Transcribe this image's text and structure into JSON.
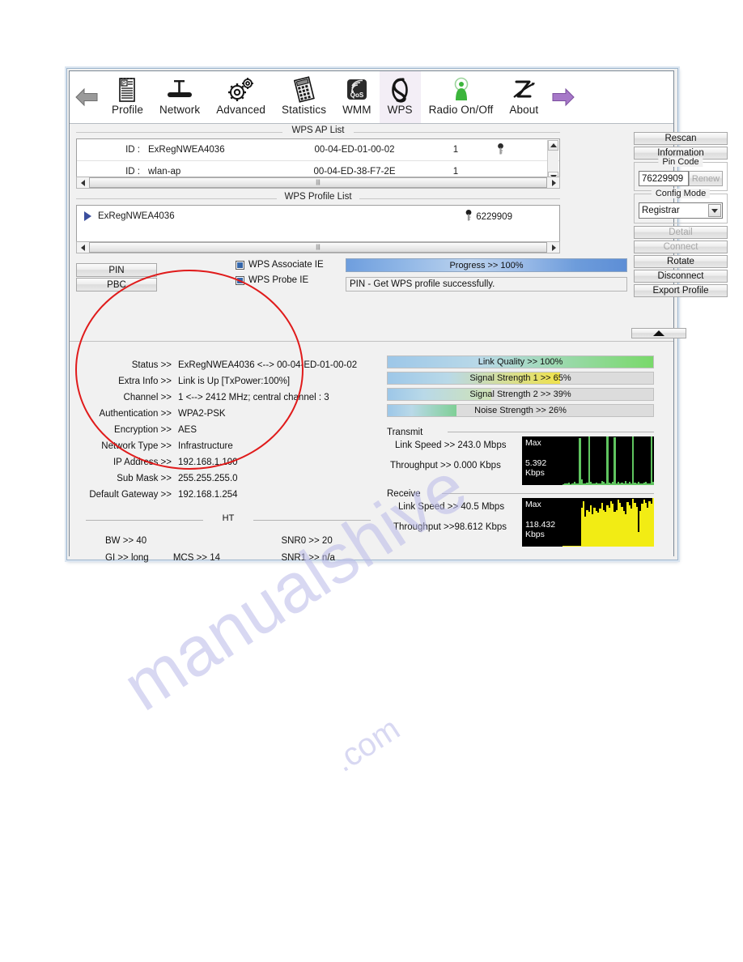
{
  "watermark": {
    "line1": "manualshive",
    "line2": ".com"
  },
  "toolbar": {
    "prev_label": "",
    "next_label": "",
    "items": [
      {
        "label": "Profile",
        "icon": "profile-icon",
        "active": false
      },
      {
        "label": "Network",
        "icon": "network-icon",
        "active": false
      },
      {
        "label": "Advanced",
        "icon": "advanced-icon",
        "active": false
      },
      {
        "label": "Statistics",
        "icon": "statistics-icon",
        "active": false
      },
      {
        "label": "WMM",
        "icon": "wmm-qos-icon",
        "active": false
      },
      {
        "label": "WPS",
        "icon": "wps-icon",
        "active": true
      },
      {
        "label": "Radio On/Off",
        "icon": "radio-icon",
        "active": false
      },
      {
        "label": "About",
        "icon": "about-icon",
        "active": false
      }
    ]
  },
  "ap_list": {
    "title": "WPS AP List",
    "rows": [
      {
        "id_label": "ID :",
        "ssid": "ExRegNWEA4036",
        "mac": "00-04-ED-01-00-02",
        "channel": "1"
      },
      {
        "id_label": "ID :",
        "ssid": "wlan-ap",
        "mac": "00-04-ED-38-F7-2E",
        "channel": "1"
      }
    ]
  },
  "profile_list": {
    "title": "WPS Profile List",
    "rows": [
      {
        "name": "ExRegNWEA4036",
        "pin": "6229909"
      }
    ]
  },
  "actions": {
    "pin_label": "PIN",
    "pbc_label": "PBC",
    "associate_ie_label": "WPS Associate IE",
    "probe_ie_label": "WPS Probe IE"
  },
  "progress": {
    "text": "Progress >> 100%",
    "percent": 100,
    "message": "PIN - Get WPS profile successfully."
  },
  "right_panel": {
    "rescan_label": "Rescan",
    "information_label": "Information",
    "pin_code_legend": "Pin Code",
    "pin_code_value": "76229909",
    "renew_label": "Renew",
    "config_mode_legend": "Config Mode",
    "config_mode_value": "Registrar",
    "detail_label": "Detail",
    "connect_label": "Connect",
    "rotate_label": "Rotate",
    "disconnect_label": "Disconnect",
    "export_profile_label": "Export Profile"
  },
  "status": {
    "rows": [
      {
        "label": "Status >>",
        "value": "ExRegNWEA4036 <-->  00-04-ED-01-00-02"
      },
      {
        "label": "Extra Info >>",
        "value": "Link is Up [TxPower:100%]"
      },
      {
        "label": "Channel >>",
        "value": "1 <--> 2412 MHz; central channel : 3"
      },
      {
        "label": "Authentication >>",
        "value": "WPA2-PSK"
      },
      {
        "label": "Encryption >>",
        "value": "AES"
      },
      {
        "label": "Network Type >>",
        "value": "Infrastructure"
      },
      {
        "label": "IP Address >>",
        "value": "192.168.1.100"
      },
      {
        "label": "Sub Mask >>",
        "value": "255.255.255.0"
      },
      {
        "label": "Default Gateway >>",
        "value": "192.168.1.254"
      }
    ]
  },
  "ht": {
    "title": "HT",
    "bw": "BW >> 40",
    "snr0": "SNR0 >>   20",
    "gi": "GI >> long",
    "mcs": "MCS >>    14",
    "snr1": "SNR1 >>  n/a"
  },
  "signal": {
    "bars": [
      {
        "label": "Link Quality >> 100%",
        "percent": 100,
        "color": "#79d96a"
      },
      {
        "label": "Signal Strength 1 >> 65%",
        "percent": 65,
        "color": "#f0e24a"
      },
      {
        "label": "Signal Strength 2 >> 39%",
        "percent": 39,
        "color": "#cfe2b5"
      },
      {
        "label": "Noise Strength >> 26%",
        "percent": 26,
        "color": "#7fcf96"
      }
    ]
  },
  "transmit": {
    "title": "Transmit",
    "link_speed": "Link Speed >>  243.0 Mbps",
    "throughput": "Throughput >> 0.000 Kbps",
    "graph_max_label": "Max",
    "graph_value": "5.392",
    "graph_unit": "Kbps",
    "graph_color": "#5fc45f"
  },
  "receive": {
    "title": "Receive",
    "link_speed": "Link Speed >> 40.5 Mbps",
    "throughput": "Throughput >>98.612 Kbps",
    "graph_max_label": "Max",
    "graph_value": "118.432",
    "graph_unit": "Kbps",
    "graph_color": "#f2ec14"
  },
  "chart_data": [
    {
      "type": "bar",
      "title": "Transmit Throughput",
      "ylabel": "Kbps",
      "ymax_label": "Max",
      "ylim": [
        0,
        5.392
      ],
      "color": "#5fc45f",
      "values": [
        2,
        4,
        3,
        5,
        2,
        3,
        6,
        4,
        3,
        96,
        12,
        4,
        3,
        5,
        100,
        6,
        4,
        3,
        5,
        4,
        3,
        8,
        6,
        4,
        100,
        5,
        3,
        7,
        98,
        4,
        6,
        3,
        5,
        4,
        9,
        3,
        6,
        4,
        100,
        5,
        3,
        6,
        4,
        3,
        5,
        7,
        4,
        3,
        100,
        6
      ]
    },
    {
      "type": "bar",
      "title": "Receive Throughput",
      "ylabel": "Kbps",
      "ymax_label": "Max",
      "ylim": [
        0,
        118.432
      ],
      "color": "#f2ec14",
      "values": [
        0,
        0,
        0,
        0,
        0,
        0,
        0,
        0,
        0,
        0,
        78,
        92,
        60,
        74,
        70,
        83,
        66,
        79,
        72,
        68,
        76,
        88,
        74,
        70,
        84,
        78,
        92,
        86,
        70,
        74,
        95,
        88,
        80,
        72,
        66,
        90,
        84,
        76,
        96,
        88,
        80,
        30,
        72,
        86,
        94,
        88,
        78,
        92,
        86,
        98
      ]
    }
  ],
  "annotation": {
    "shape": "ellipse",
    "color": "#e01b1b"
  }
}
